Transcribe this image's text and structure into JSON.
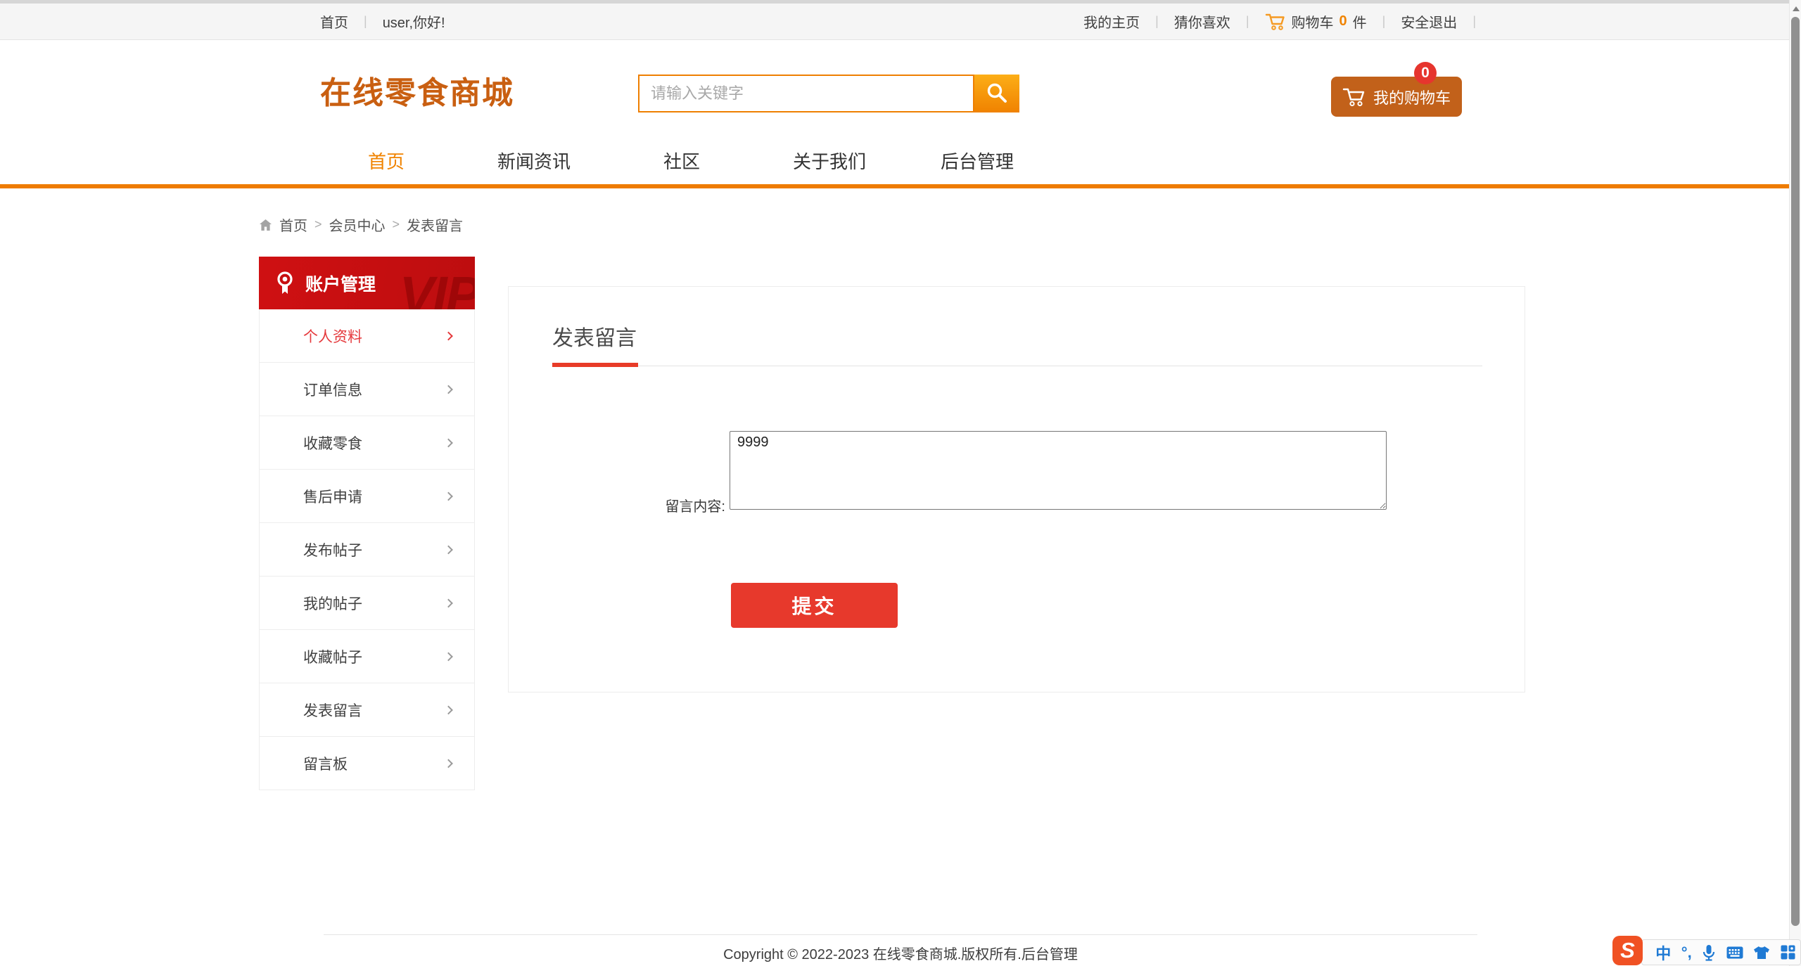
{
  "topbar": {
    "home": "首页",
    "greeting": "user,你好!",
    "my_home": "我的主页",
    "guess_you_like": "猜你喜欢",
    "cart_label": "购物车",
    "cart_count": "0",
    "cart_unit": "件",
    "logout": "安全退出"
  },
  "header": {
    "logo": "在线零食商城",
    "search_placeholder": "请输入关键字",
    "cart_button_label": "我的购物车",
    "cart_badge": "0"
  },
  "nav": {
    "items": [
      {
        "label": "首页",
        "active": true
      },
      {
        "label": "新闻资讯",
        "active": false
      },
      {
        "label": "社区",
        "active": false
      },
      {
        "label": "关于我们",
        "active": false
      },
      {
        "label": "后台管理",
        "active": false
      }
    ]
  },
  "breadcrumb": {
    "separator": ">",
    "items": [
      {
        "label": "首页"
      },
      {
        "label": "会员中心"
      },
      {
        "label": "发表留言"
      }
    ]
  },
  "sidebar": {
    "title": "账户管理",
    "watermark": "VIP",
    "items": [
      {
        "label": "个人资料",
        "active": true
      },
      {
        "label": "订单信息",
        "active": false
      },
      {
        "label": "收藏零食",
        "active": false
      },
      {
        "label": "售后申请",
        "active": false
      },
      {
        "label": "发布帖子",
        "active": false
      },
      {
        "label": "我的帖子",
        "active": false
      },
      {
        "label": "收藏帖子",
        "active": false
      },
      {
        "label": "发表留言",
        "active": false
      },
      {
        "label": "留言板",
        "active": false
      }
    ]
  },
  "main": {
    "title": "发表留言",
    "form": {
      "label": "留言内容:",
      "textarea_value": "9999",
      "submit_label": "提交"
    }
  },
  "footer": {
    "copyright": "Copyright © 2022-2023 在线零食商城.版权所有.",
    "admin_link": "后台管理"
  },
  "ime": {
    "logo_letter": "S",
    "chinese_mode": "中",
    "punctuation": "°,"
  },
  "colors": {
    "brand_orange": "#ee7c00",
    "logo_orange": "#c95f11",
    "cart_button_brown": "#c2611a",
    "sidebar_red": "#c70f10",
    "active_red": "#e5393c",
    "submit_red": "#e7392c",
    "badge_red": "#e6352e",
    "topbar_gray": "#f5f5f5"
  }
}
